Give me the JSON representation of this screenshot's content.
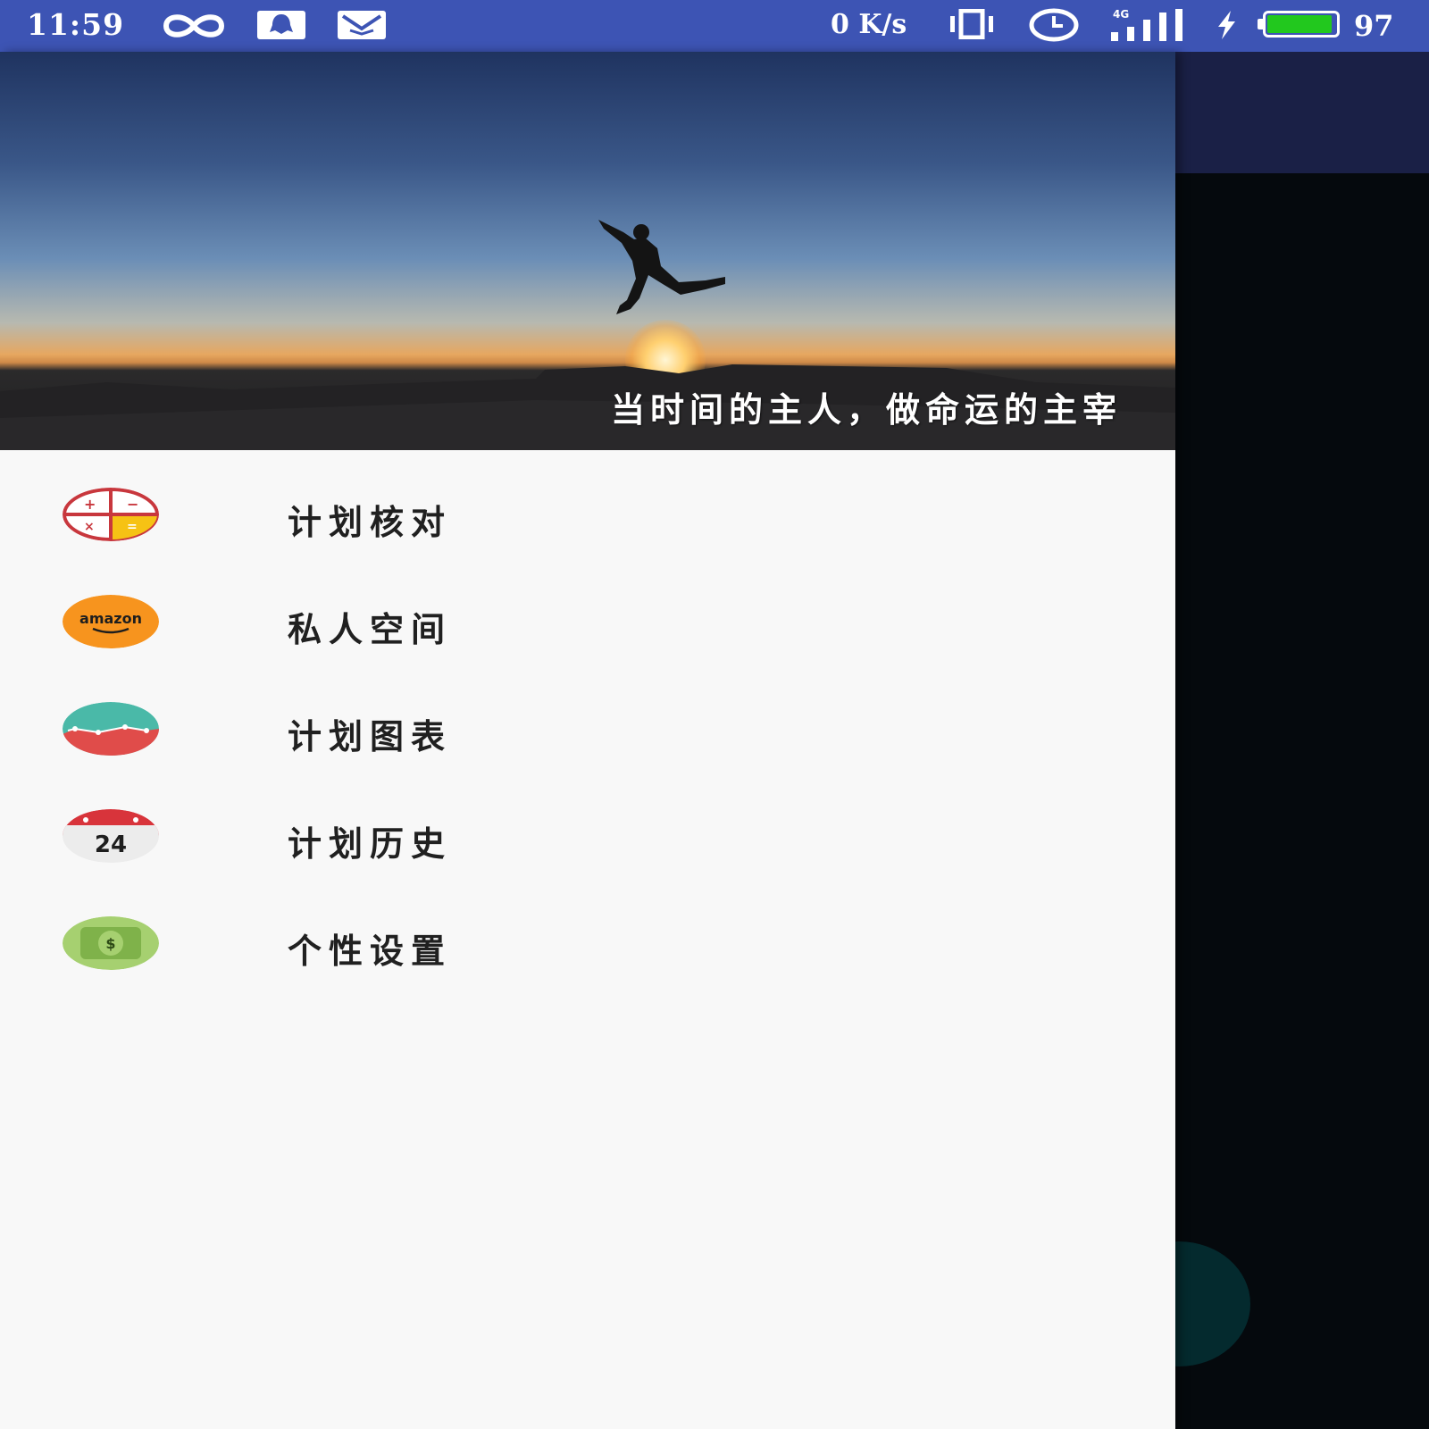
{
  "status_bar": {
    "time": "11:59",
    "net_speed": "0 K/s",
    "battery_level": "97",
    "battery_fraction": 0.97,
    "icons": [
      "infinity-icon",
      "qq-icon",
      "mail-icon",
      "vibrate-icon",
      "alarm-icon",
      "signal-4g-icon",
      "charging-icon",
      "battery-icon"
    ],
    "network_label": "4G",
    "background": "#3d54b4"
  },
  "drawer": {
    "header": {
      "motto": "当时间的主人，做命运的主宰"
    },
    "menu": [
      {
        "label": "计划核对",
        "icon": "calculator-icon"
      },
      {
        "label": "私人空间",
        "icon": "amazon-icon",
        "icon_text": "amazon"
      },
      {
        "label": "计划图表",
        "icon": "chart-icon"
      },
      {
        "label": "计划历史",
        "icon": "calendar-icon",
        "icon_text": "24"
      },
      {
        "label": "个性设置",
        "icon": "money-icon",
        "icon_text": "$"
      }
    ]
  },
  "colors": {
    "drawer_bg": "#f8f8f8",
    "scrim": "#05090d",
    "appbar_behind": "#1a2046",
    "battery_fill": "#22c81e"
  }
}
